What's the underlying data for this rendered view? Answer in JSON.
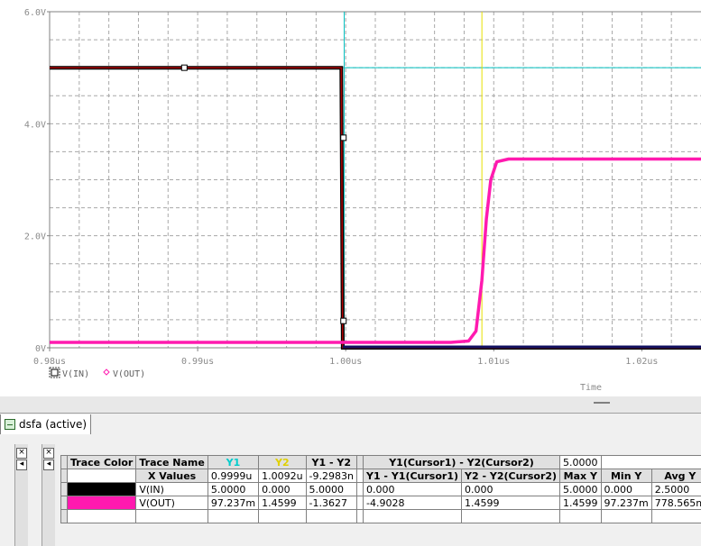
{
  "colors": {
    "trace_in": "#b00000",
    "trace_in_outline": "#000000",
    "trace_out": "#ff1aaf",
    "cursor1": "#00c0c0",
    "cursor2": "#e8e000",
    "grid": "#a8a8a8",
    "axis": "#808080",
    "in_swatch": "#000000",
    "out_swatch": "#ff1aaf"
  },
  "chart_data": {
    "type": "line",
    "xlabel": "Time",
    "ylabel": "",
    "xlim": [
      0.98,
      1.024
    ],
    "ylim": [
      0,
      6
    ],
    "x_ticks": [
      {
        "value": 0.98,
        "label": "0.98us"
      },
      {
        "value": 0.99,
        "label": "0.99us"
      },
      {
        "value": 1.0,
        "label": "1.00us"
      },
      {
        "value": 1.01,
        "label": "1.01us"
      },
      {
        "value": 1.02,
        "label": "1.02us"
      }
    ],
    "y_ticks": [
      {
        "value": 0,
        "label": "0V"
      },
      {
        "value": 2,
        "label": "2.0V"
      },
      {
        "value": 4,
        "label": "4.0V"
      },
      {
        "value": 6,
        "label": "6.0V"
      }
    ],
    "grid": true,
    "series": [
      {
        "name": "V(IN)",
        "marker": "square",
        "points": [
          [
            0.98,
            5.0
          ],
          [
            0.9997,
            5.0
          ],
          [
            0.9998,
            0.0
          ],
          [
            1.024,
            0.0
          ]
        ],
        "markers_at": [
          [
            0.9891,
            5.0
          ],
          [
            0.99985,
            3.75
          ],
          [
            0.99985,
            0.48
          ]
        ]
      },
      {
        "name": "V(OUT)",
        "marker": "diamond",
        "points": [
          [
            0.98,
            0.097
          ],
          [
            1.0,
            0.097
          ],
          [
            1.0071,
            0.097
          ],
          [
            1.0083,
            0.12
          ],
          [
            1.0088,
            0.3
          ],
          [
            1.0092,
            1.2
          ],
          [
            1.0095,
            2.3
          ],
          [
            1.0098,
            3.0
          ],
          [
            1.0102,
            3.32
          ],
          [
            1.011,
            3.37
          ],
          [
            1.024,
            3.37
          ]
        ]
      }
    ],
    "cursors": [
      {
        "name": "Cursor1",
        "x": 0.9999,
        "y": 5.0
      },
      {
        "name": "Cursor2",
        "x": 1.0092,
        "y": null
      }
    ]
  },
  "tab": {
    "label": "dsfa (active)"
  },
  "table": {
    "header_row1": [
      "Trace Color",
      "Trace Name",
      "Y1",
      "Y2",
      "Y1 - Y2",
      "",
      "Y1(Cursor1) - Y2(Cursor2)",
      "5.0000",
      ""
    ],
    "header_row2": [
      "",
      "X Values",
      "0.9999u",
      "1.0092u",
      "-9.2983n",
      "",
      "Y1 - Y1(Cursor1)",
      "Y2 - Y2(Cursor2)",
      "Max Y",
      "Min Y",
      "Avg Y"
    ],
    "rows": [
      {
        "name": "V(IN)",
        "cells": [
          "5.0000",
          "0.000",
          "5.0000",
          "",
          "0.000",
          "0.000",
          "5.0000",
          "0.000",
          "2.5000"
        ]
      },
      {
        "name": "V(OUT)",
        "cells": [
          "97.237m",
          "1.4599",
          "-1.3627",
          "",
          "-4.9028",
          "1.4599",
          "1.4599",
          "97.237m",
          "778.565m"
        ]
      }
    ],
    "close_glyph": "×"
  }
}
